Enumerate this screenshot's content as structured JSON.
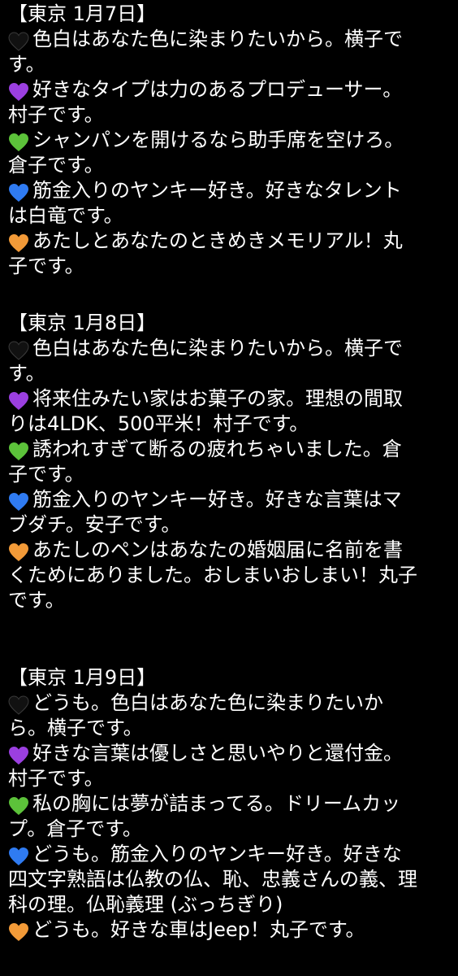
{
  "colors": {
    "background": "#000000",
    "text": "#ffffff",
    "hearts": {
      "black-heart-icon": "#111111",
      "purple-heart-icon": "#9b3fe0",
      "green-heart-icon": "#5cc23a",
      "blue-heart-icon": "#2f7bf2",
      "orange-heart-icon": "#f29a38"
    }
  },
  "sections": [
    {
      "heading": "【東京 1月7日】",
      "entries": [
        {
          "icon": "black-heart-icon",
          "lines": [
            "色白はあなた色に染まりたいから。横子で",
            "す。"
          ]
        },
        {
          "icon": "purple-heart-icon",
          "lines": [
            "好きなタイプは力のあるプロデューサー。",
            "村子です。"
          ]
        },
        {
          "icon": "green-heart-icon",
          "lines": [
            "シャンパンを開けるなら助手席を空けろ。",
            "倉子です。"
          ]
        },
        {
          "icon": "blue-heart-icon",
          "lines": [
            "筋金入りのヤンキー好き。好きなタレント",
            "は白竜です。"
          ]
        },
        {
          "icon": "orange-heart-icon",
          "lines": [
            "あたしとあなたのときめきメモリアル！丸",
            "子です。"
          ]
        }
      ]
    },
    {
      "heading": "【東京 1月8日】",
      "entries": [
        {
          "icon": "black-heart-icon",
          "lines": [
            "色白はあなた色に染まりたいから。横子で",
            "す。"
          ]
        },
        {
          "icon": "purple-heart-icon",
          "lines": [
            "将来住みたい家はお菓子の家。理想の間取",
            "りは4LDK、500平米！村子です。"
          ]
        },
        {
          "icon": "green-heart-icon",
          "lines": [
            "誘われすぎて断るの疲れちゃいました。倉",
            "子です。"
          ]
        },
        {
          "icon": "blue-heart-icon",
          "lines": [
            "筋金入りのヤンキー好き。好きな言葉はマ",
            "ブダチ。安子です。"
          ]
        },
        {
          "icon": "orange-heart-icon",
          "lines": [
            "あたしのペンはあなたの婚姻届に名前を書",
            "くためにありました。おしまいおしまい！丸子",
            "です。"
          ]
        }
      ]
    },
    {
      "heading": "【東京 1月9日】",
      "entries": [
        {
          "icon": "black-heart-icon",
          "lines": [
            "どうも。色白はあなた色に染まりたいか",
            "ら。横子です。"
          ]
        },
        {
          "icon": "purple-heart-icon",
          "lines": [
            "好きな言葉は優しさと思いやりと還付金。",
            "村子です。"
          ]
        },
        {
          "icon": "green-heart-icon",
          "lines": [
            "私の胸には夢が詰まってる。ドリームカッ",
            "プ。倉子です。"
          ]
        },
        {
          "icon": "blue-heart-icon",
          "lines": [
            "どうも。筋金入りのヤンキー好き。好きな",
            "四文字熟語は仏教の仏、恥、忠義さんの義、理",
            "科の理。仏恥義理 (ぶっちぎり)"
          ]
        },
        {
          "icon": "orange-heart-icon",
          "lines": [
            "どうも。好きな車はJeep！丸子です。"
          ]
        }
      ]
    }
  ]
}
